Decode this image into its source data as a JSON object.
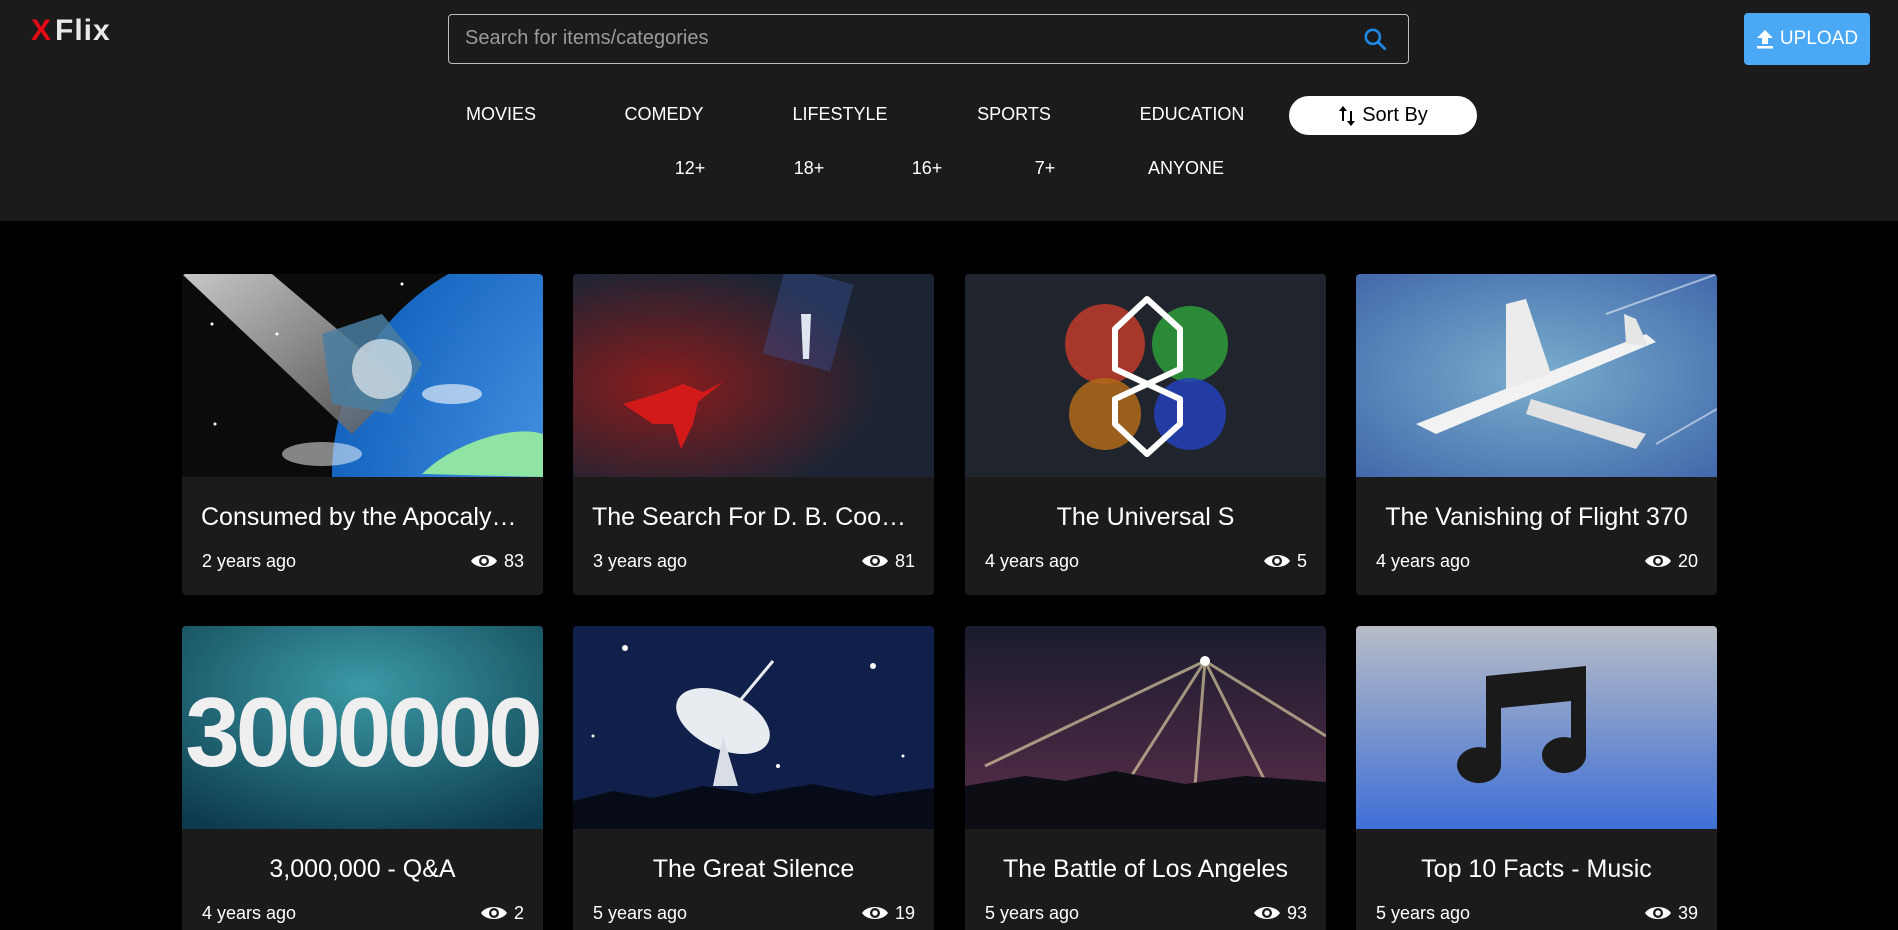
{
  "app": {
    "logo_x": "X",
    "logo_text": "Flix"
  },
  "search": {
    "placeholder": "Search for items/categories",
    "icon": "search-icon"
  },
  "upload": {
    "label": "UPLOAD",
    "icon": "upload-icon"
  },
  "genres": [
    "MOVIES",
    "COMEDY",
    "LIFESTYLE",
    "SPORTS",
    "EDUCATION"
  ],
  "sort": {
    "label": "Sort By",
    "icon": "sort-icon"
  },
  "ages": [
    "12+",
    "18+",
    "16+",
    "7+",
    "ANYONE"
  ],
  "colors": {
    "accent": "#4aa8f5",
    "brand_red": "#e50914",
    "header_bg": "#1b1b1b",
    "card_bg": "#1b1b1b"
  },
  "cards": [
    {
      "title": "Consumed by the Apocalypse",
      "age": "2 years ago",
      "views": "83",
      "thumb": "earth-meteor"
    },
    {
      "title": "The Search For D. B. Cooper",
      "age": "3 years ago",
      "views": "81",
      "thumb": "skydiver"
    },
    {
      "title": "The Universal S",
      "age": "4 years ago",
      "views": "5",
      "thumb": "paint-s"
    },
    {
      "title": "The Vanishing of Flight 370",
      "age": "4 years ago",
      "views": "20",
      "thumb": "airplane"
    },
    {
      "title": "3,000,000 - Q&A",
      "age": "4 years ago",
      "views": "2",
      "thumb": "3000000"
    },
    {
      "title": "The Great Silence",
      "age": "5 years ago",
      "views": "19",
      "thumb": "radio-dish"
    },
    {
      "title": "The Battle of Los Angeles",
      "age": "5 years ago",
      "views": "93",
      "thumb": "searchlights"
    },
    {
      "title": "Top 10 Facts - Music",
      "age": "5 years ago",
      "views": "39",
      "thumb": "music-note"
    }
  ]
}
